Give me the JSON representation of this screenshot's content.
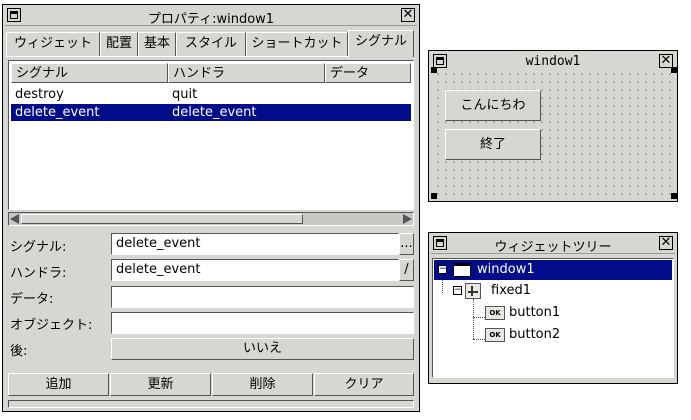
{
  "properties_window": {
    "title": "プロパティ:window1",
    "tabs": [
      "ウィジェット",
      "配置",
      "基本",
      "スタイル",
      "ショートカット",
      "シグナル"
    ],
    "active_tab": "シグナル",
    "list": {
      "columns": [
        "シグナル",
        "ハンドラ",
        "データ"
      ],
      "rows": [
        {
          "signal": "destroy",
          "handler": "quit"
        },
        {
          "signal": "delete_event",
          "handler": "delete_event"
        }
      ],
      "selected_row": 1
    },
    "form": {
      "signal_label": "シグナル:",
      "signal_value": "delete_event",
      "signal_button": "...",
      "handler_label": "ハンドラ:",
      "handler_value": "delete_event",
      "handler_button": "/",
      "data_label": "データ:",
      "data_value": "",
      "object_label": "オブジェクト:",
      "object_value": "",
      "after_label": "後:",
      "after_value": "いいえ"
    },
    "buttons": {
      "add": "追加",
      "update": "更新",
      "delete": "削除",
      "clear": "クリア"
    }
  },
  "window1": {
    "title": "window1",
    "button1_label": "こんにちわ",
    "button2_label": "終了"
  },
  "widget_tree": {
    "title": "ウィジェットツリー",
    "items": [
      "window1",
      "fixed1",
      "button1",
      "button2"
    ],
    "ok_icon_text": "OK",
    "selected_item": "window1",
    "expander_open": "−"
  },
  "colors": {
    "window_bg": "#d6d6d2",
    "selection_bg": "#000c8a",
    "selection_fg": "#ffffff"
  }
}
